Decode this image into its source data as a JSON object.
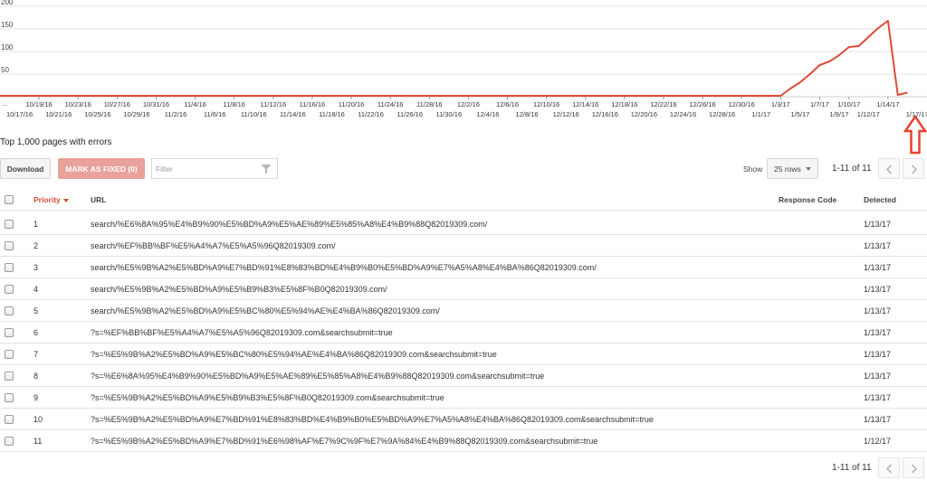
{
  "chart_data": {
    "type": "line",
    "y_ticks": [
      200,
      150,
      100,
      50
    ],
    "ylim": [
      0,
      200
    ],
    "x_labels_top": [
      "10/19/16",
      "10/23/16",
      "10/27/16",
      "10/31/16",
      "11/4/16",
      "11/8/16",
      "11/12/16",
      "11/16/16",
      "11/20/16",
      "11/24/16",
      "11/28/16",
      "12/2/16",
      "12/6/16",
      "12/10/16",
      "12/14/16",
      "12/18/16",
      "12/22/16",
      "12/26/16",
      "12/30/16",
      "1/3/17",
      "1/7/17",
      "1/10/17",
      "1/14/17"
    ],
    "x_labels_bottom": [
      "10/17/16",
      "10/21/16",
      "10/25/16",
      "10/29/16",
      "11/2/16",
      "11/6/16",
      "11/10/16",
      "11/14/16",
      "11/18/16",
      "11/22/16",
      "11/26/16",
      "11/30/16",
      "12/4/16",
      "12/8/16",
      "12/12/16",
      "12/16/16",
      "12/20/16",
      "12/24/16",
      "12/28/16",
      "1/1/17",
      "1/5/17",
      "1/9/17",
      "1/12/17",
      "1/17/17"
    ],
    "series": [
      {
        "color": "#dd4b39",
        "points": [
          [
            "10/15/16",
            2
          ],
          [
            "10/31/16",
            2
          ],
          [
            "11/30/16",
            2
          ],
          [
            "12/30/16",
            2
          ],
          [
            "1/3/17",
            2
          ],
          [
            "1/4/17",
            18
          ],
          [
            "1/5/17",
            32
          ],
          [
            "1/6/17",
            50
          ],
          [
            "1/7/17",
            70
          ],
          [
            "1/8/17",
            78
          ],
          [
            "1/9/17",
            92
          ],
          [
            "1/10/17",
            110
          ],
          [
            "1/11/17",
            112
          ],
          [
            "1/12/17",
            132
          ],
          [
            "1/13/17",
            152
          ],
          [
            "1/14/17",
            168
          ],
          [
            "1/15/17",
            4
          ],
          [
            "1/16/17",
            9
          ]
        ]
      }
    ],
    "grid": true,
    "x_label_leading": "..."
  },
  "section_title": "Top 1,000 pages with errors",
  "toolbar": {
    "download_label": "Download",
    "mark_fixed_label": "MARK AS FIXED (0)",
    "filter_placeholder": "Filter",
    "show_label": "Show",
    "rows_value": "25 rows",
    "pager_text": "1-11 of 11"
  },
  "table": {
    "headers": {
      "priority": "Priority",
      "url": "URL",
      "response_code": "Response Code",
      "detected": "Detected"
    },
    "rows": [
      {
        "priority": "1",
        "url": "search/%E6%8A%95%E4%B9%90%E5%BD%A9%E5%AE%89%E5%85%A8%E4%B9%88Q82019309.com/",
        "code": "",
        "detected": "1/13/17"
      },
      {
        "priority": "2",
        "url": "search/%EF%BB%BF%E5%A4%A7%E5%A5%96Q82019309.com/",
        "code": "",
        "detected": "1/13/17"
      },
      {
        "priority": "3",
        "url": "search/%E5%9B%A2%E5%BD%A9%E7%BD%91%E8%83%BD%E4%B9%B0%E5%BD%A9%E7%A5%A8%E4%BA%86Q82019309.com/",
        "code": "",
        "detected": "1/13/17"
      },
      {
        "priority": "4",
        "url": "search/%E5%9B%A2%E5%BD%A9%E5%B9%B3%E5%8F%B0Q82019309.com/",
        "code": "",
        "detected": "1/13/17"
      },
      {
        "priority": "5",
        "url": "search/%E5%9B%A2%E5%BD%A9%E5%BC%80%E5%94%AE%E4%BA%86Q82019309.com/",
        "code": "",
        "detected": "1/13/17"
      },
      {
        "priority": "6",
        "url": "?s=%EF%BB%BF%E5%A4%A7%E5%A5%96Q82019309.com&searchsubmit=true",
        "code": "",
        "detected": "1/13/17"
      },
      {
        "priority": "7",
        "url": "?s=%E5%9B%A2%E5%BD%A9%E5%BC%80%E5%94%AE%E4%BA%86Q82019309.com&searchsubmit=true",
        "code": "",
        "detected": "1/13/17"
      },
      {
        "priority": "8",
        "url": "?s=%E6%8A%95%E4%B9%90%E5%BD%A9%E5%AE%89%E5%85%A8%E4%B9%88Q82019309.com&searchsubmit=true",
        "code": "",
        "detected": "1/13/17"
      },
      {
        "priority": "9",
        "url": "?s=%E5%9B%A2%E5%BD%A9%E5%B9%B3%E5%8F%B0Q82019309.com&searchsubmit=true",
        "code": "",
        "detected": "1/13/17"
      },
      {
        "priority": "10",
        "url": "?s=%E5%9B%A2%E5%BD%A9%E7%BD%91%E8%83%BD%E4%B9%B0%E5%BD%A9%E7%A5%A8%E4%BA%86Q82019309.com&searchsubmit=true",
        "code": "",
        "detected": "1/13/17"
      },
      {
        "priority": "11",
        "url": "?s=%E5%9B%A2%E5%BD%A9%E7%BD%91%E6%98%AF%E7%9C%9F%E7%9A%84%E4%B9%88Q82019309.com&searchsubmit=true",
        "code": "",
        "detected": "1/12/17"
      }
    ]
  },
  "bottom_pager": {
    "pager_text": "1-11 of 11"
  },
  "annotation": {
    "arrow_color": "#e8412f"
  }
}
